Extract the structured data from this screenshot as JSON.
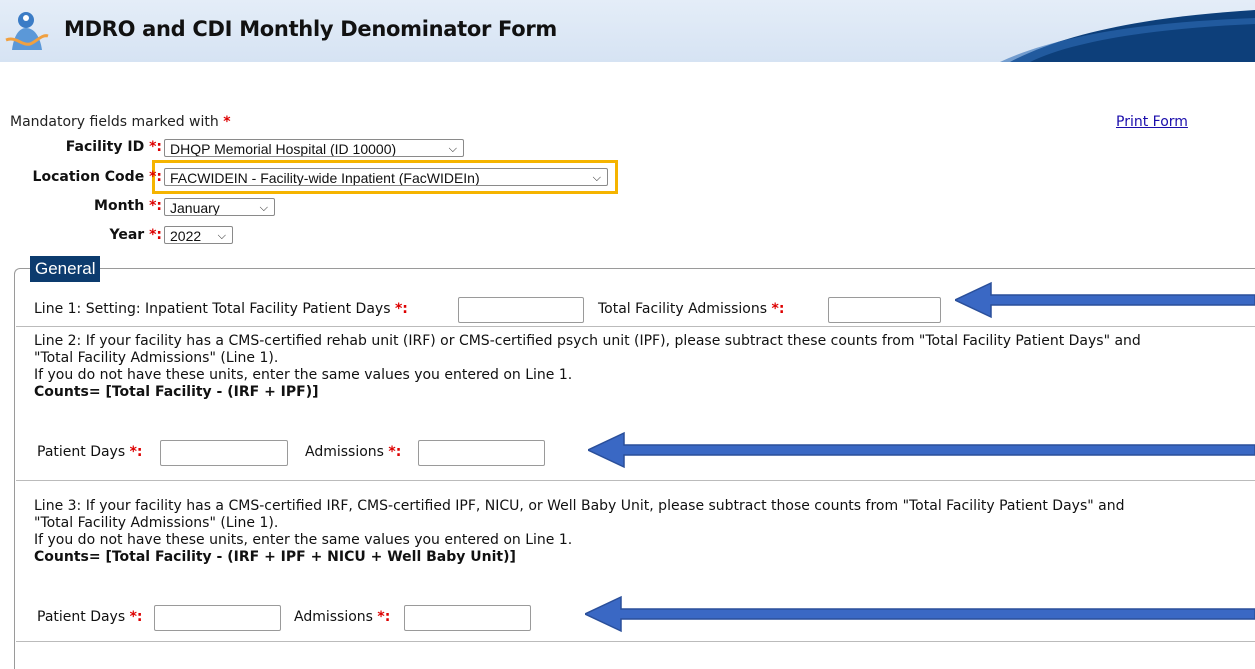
{
  "header": {
    "title": "MDRO and CDI Monthly Denominator Form"
  },
  "mandatory_note": {
    "text": "Mandatory fields marked with",
    "star": "*"
  },
  "print_link": "Print Form",
  "fields": {
    "facility_id": {
      "label": "Facility ID",
      "value": "DHQP Memorial Hospital (ID 10000)"
    },
    "location_code": {
      "label": "Location Code",
      "value": "FACWIDEIN - Facility-wide Inpatient (FacWIDEIn)"
    },
    "month": {
      "label": "Month",
      "value": "January"
    },
    "year": {
      "label": "Year",
      "value": "2022"
    }
  },
  "required_suffix": "*:",
  "section": {
    "legend": "General"
  },
  "line1": {
    "text": "Line 1: Setting: Inpatient  Total Facility Patient Days",
    "admissions_label": "Total Facility Admissions"
  },
  "line2": {
    "text1": "Line 2: If your facility has a CMS-certified rehab unit (IRF) or CMS-certified psych unit (IPF), please subtract these counts from \"Total Facility Patient Days\" and",
    "text2": "\"Total Facility Admissions\" (Line 1).",
    "text3": "If you do not have these units, enter the same values you entered on Line 1.",
    "counts": "Counts= [Total Facility - (IRF + IPF)]",
    "patient_days_label": "Patient Days",
    "admissions_label": "Admissions"
  },
  "line3": {
    "text1": "Line 3: If your facility has a CMS-certified IRF, CMS-certified IPF, NICU, or Well Baby Unit, please subtract those counts from \"Total Facility Patient Days\" and",
    "text2": "\"Total Facility Admissions\" (Line 1).",
    "text3": "If you do not have these units, enter the same values you entered on Line 1.",
    "counts": "Counts= [Total Facility - (IRF + IPF + NICU + Well Baby Unit)]",
    "patient_days_label": "Patient Days",
    "admissions_label": "Admissions"
  },
  "colors": {
    "highlight": "#f5b400",
    "arrow": "#3a68c4",
    "legend_bg": "#0c3b6e",
    "required": "#dd0000"
  },
  "icons": [
    "nhsn-logo-icon",
    "chevron-down-icon",
    "arrow-left-icon"
  ]
}
